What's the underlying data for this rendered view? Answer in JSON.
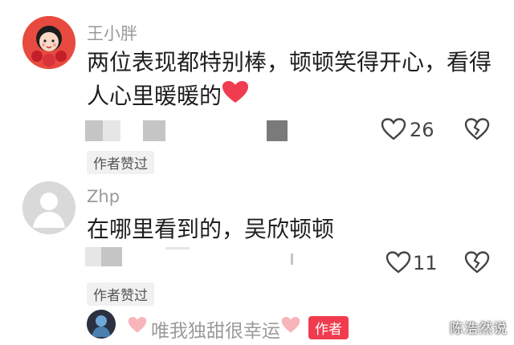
{
  "comments": [
    {
      "username": "王小胖",
      "text_line1": "两位表现都特别棒，顿顿笑得开心，看得",
      "text_line2": "人心里暖暖的",
      "emoji_icon": "red-heart-icon",
      "likes": "26",
      "author_liked_tag": "作者赞过"
    },
    {
      "username": "Zhp",
      "text_line1": "在哪里看到的，吴欣顿顿",
      "likes": "11",
      "author_liked_tag": "作者赞过"
    }
  ],
  "reply": {
    "text": "唯我独甜很幸运",
    "author_badge": "作者"
  },
  "watermark": "陈浩然说",
  "colors": {
    "heart_red": "#f03c4e",
    "pink_heart": "#f7b5b9",
    "avatar_red": "#e84a3f"
  }
}
